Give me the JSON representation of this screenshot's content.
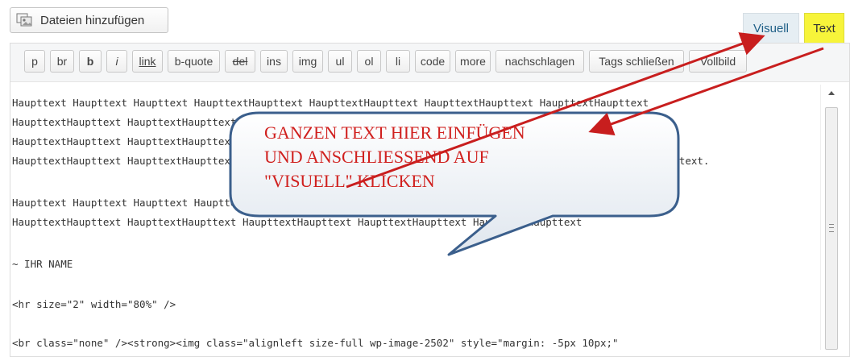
{
  "media_button": {
    "label": "Dateien hinzufügen",
    "icon": "add-media-icon"
  },
  "tabs": {
    "visual": "Visuell",
    "text": "Text"
  },
  "toolbar": {
    "buttons": [
      "p",
      "br",
      "b",
      "i",
      "link",
      "b-quote",
      "del",
      "ins",
      "img",
      "ul",
      "ol",
      "li",
      "code",
      "more",
      "nachschlagen",
      "Tags schließen",
      "Vollbild"
    ]
  },
  "content": {
    "lines": [
      "Haupttext Haupttext Haupttext HaupttextHaupttext HaupttextHaupttext HaupttextHaupttext HaupttextHaupttext",
      "HaupttextHaupttext HaupttextHaupttext HaupttextHaupttext HaupttextHaupttext HaupttextHaupttext Haupttext",
      "HaupttextHaupttext HaupttextHaupttext HaupttextHaupttext HaupttextHaupttext HaupttextHaupttext Haupttext",
      "HaupttextHaupttext HaupttextHaupttext HaupttextHaupttext HaupttextHaupttext HaupttextHaupttext Haupttext Haupttext.",
      "Haupttext Haupttext Haupttext HaupttextHaupttext HaupttextHaupttext HaupttextHaupttext HaupttextHaupttext",
      "HaupttextHaupttext HaupttextHaupttext HaupttextHaupttext HaupttextHaupttext HaupttextHaupttext",
      "~ IHR NAME",
      "<hr size=\"2\" width=\"80%\" />",
      "<br class=\"none\" /><strong><img class=\"alignleft size-full wp-image-2502\" style=\"margin: -5px 10px;\""
    ]
  },
  "callout": {
    "lines": [
      "GANZEN TEXT HIER EINFÜGEN",
      "UND ANSCHLIESSEND AUF",
      "\"VISUELL\" KLICKEN"
    ],
    "color": "#d0201e"
  },
  "colors": {
    "text_tab_highlight": "#f7f43a",
    "arrow": "#c81e1e"
  }
}
